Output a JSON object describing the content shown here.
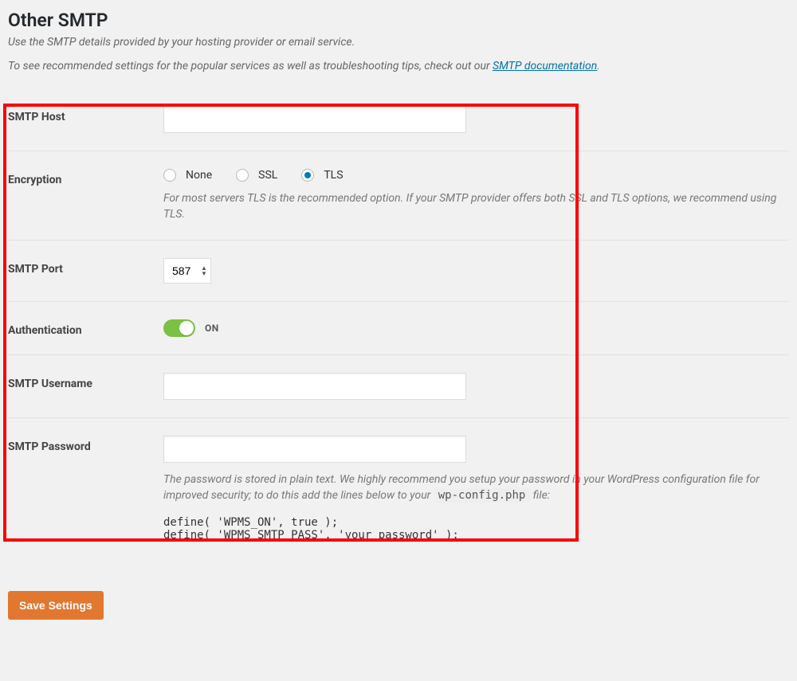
{
  "section": {
    "title": "Other SMTP",
    "intro_1": "Use the SMTP details provided by your hosting provider or email service.",
    "intro_2_prefix": "To see recommended settings for the popular services as well as troubleshooting tips, check out our ",
    "intro_2_link": "SMTP documentation",
    "intro_2_suffix": "."
  },
  "fields": {
    "host": {
      "label": "SMTP Host",
      "value": ""
    },
    "encryption": {
      "label": "Encryption",
      "options": [
        "None",
        "SSL",
        "TLS"
      ],
      "selected": "TLS",
      "desc": "For most servers TLS is the recommended option. If your SMTP provider offers both SSL and TLS options, we recommend using TLS."
    },
    "port": {
      "label": "SMTP Port",
      "value": "587"
    },
    "auth": {
      "label": "Authentication",
      "on_label": "ON",
      "on": true
    },
    "username": {
      "label": "SMTP Username",
      "value": ""
    },
    "password": {
      "label": "SMTP Password",
      "value": "",
      "desc_prefix": "The password is stored in plain text. We highly recommend you setup your password in your WordPress configuration file for improved security; to do this add the lines below to your ",
      "desc_code": "wp-config.php",
      "desc_suffix": " file:",
      "code": "define( 'WPMS_ON', true );\ndefine( 'WPMS_SMTP_PASS', 'your_password' );"
    }
  },
  "buttons": {
    "save": "Save Settings"
  }
}
